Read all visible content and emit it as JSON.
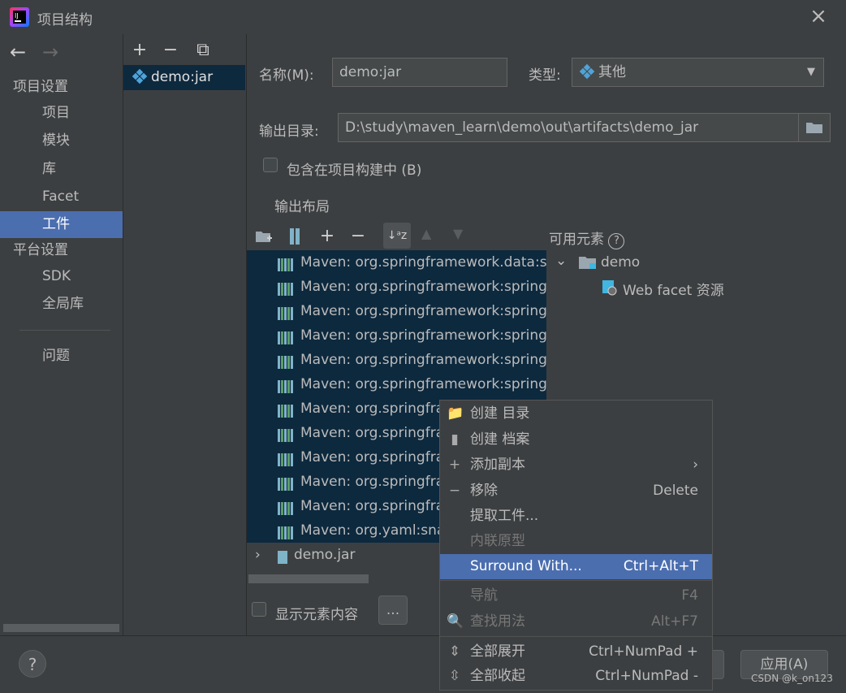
{
  "window": {
    "title": "项目结构",
    "close_icon": "×"
  },
  "nav": {
    "back": "←",
    "forward": "→",
    "project_settings": "项目设置",
    "items": [
      "项目",
      "模块",
      "库",
      "Facet",
      "工件"
    ],
    "platform_settings": "平台设置",
    "platform_items": [
      "SDK",
      "全局库"
    ],
    "problems": "问题",
    "selected": "工件"
  },
  "artifacts": {
    "toolbar": {
      "add": "+",
      "remove": "−",
      "copy": "⧉"
    },
    "items": [
      "demo:jar"
    ]
  },
  "form": {
    "name_label": "名称(M):",
    "name_value": "demo:jar",
    "type_label": "类型:",
    "type_value": "其他",
    "outdir_label": "输出目录:",
    "outdir_value": "D:\\study\\maven_learn\\demo\\out\\artifacts\\demo_jar",
    "include_label": "包含在项目构建中 (B)",
    "layout_label": "输出布局",
    "available_label": "可用元素"
  },
  "layout_tree": {
    "rows": [
      "Maven: org.springframework.data:s",
      "Maven: org.springframework:spring",
      "Maven: org.springframework:spring",
      "Maven: org.springframework:spring",
      "Maven: org.springframework:spring",
      "Maven: org.springframework:spring",
      "Maven: org.springfra",
      "Maven: org.springfra",
      "Maven: org.springfra",
      "Maven: org.springfra",
      "Maven: org.springfra",
      "Maven: org.yaml:sna"
    ],
    "jar_row": "demo.jar"
  },
  "available_tree": {
    "root": "demo",
    "child": "Web facet 资源"
  },
  "bottom": {
    "show_content_label": "显示元素内容",
    "more_button": "...",
    "apply_button": "应用(A)",
    "help": "?"
  },
  "context_menu": {
    "items": [
      {
        "label": "创建 目录",
        "shortcut": ""
      },
      {
        "label": "创建 档案",
        "shortcut": ""
      },
      {
        "label": "添加副本",
        "shortcut": "›"
      },
      {
        "label": "移除",
        "shortcut": "Delete"
      },
      {
        "label": "提取工件...",
        "shortcut": ""
      },
      {
        "label": "内联原型",
        "shortcut": ""
      },
      {
        "label": "Surround With...",
        "shortcut": "Ctrl+Alt+T"
      },
      {
        "label": "导航",
        "shortcut": "F4"
      },
      {
        "label": "查找用法",
        "shortcut": "Alt+F7"
      },
      {
        "label": "全部展开",
        "shortcut": "Ctrl+NumPad +"
      },
      {
        "label": "全部收起",
        "shortcut": "Ctrl+NumPad -"
      }
    ]
  },
  "watermark": "CSDN @k_on123",
  "colors": {
    "selection": "#4b6eaf",
    "tree_selection": "#0d293e",
    "background": "#3c3f41"
  }
}
